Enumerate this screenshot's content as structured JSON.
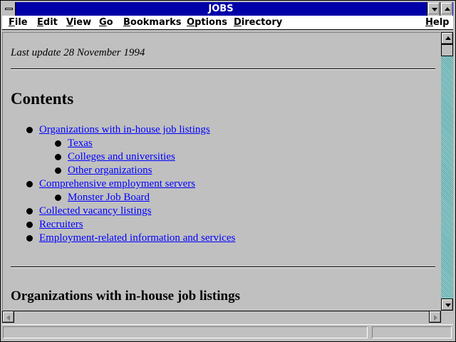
{
  "window": {
    "title": "JOBS"
  },
  "menubar": {
    "items": [
      {
        "label": "File",
        "ul": "F",
        "rest": "ile"
      },
      {
        "label": "Edit",
        "ul": "E",
        "rest": "dit"
      },
      {
        "label": "View",
        "ul": "V",
        "rest": "iew"
      },
      {
        "label": "Go",
        "ul": "G",
        "rest": "o"
      },
      {
        "label": "Bookmarks",
        "ul": "B",
        "rest": "ookmarks"
      },
      {
        "label": "Options",
        "ul": "O",
        "rest": "ptions"
      },
      {
        "label": "Directory",
        "ul": "D",
        "rest": "irectory"
      },
      {
        "label": "Help",
        "ul": "H",
        "rest": "elp"
      }
    ]
  },
  "document": {
    "last_update": "Last update 28 November 1994",
    "contents_heading": "Contents",
    "toc": [
      {
        "label": "Organizations with in-house job listings",
        "level": 1
      },
      {
        "label": "Texas",
        "level": 2
      },
      {
        "label": "Colleges and universities",
        "level": 2
      },
      {
        "label": "Other organizations",
        "level": 2
      },
      {
        "label": "Comprehensive employment servers",
        "level": 1
      },
      {
        "label": "Monster Job Board",
        "level": 2
      },
      {
        "label": "Collected vacancy listings",
        "level": 1
      },
      {
        "label": "Recruiters",
        "level": 1
      },
      {
        "label": "Employment-related information and services",
        "level": 1
      }
    ],
    "section_heading": "Organizations with in-house job listings"
  },
  "scrollbars": {
    "vertical_icons": [
      "scroll-up-arrow-icon",
      "scroll-down-arrow-icon"
    ],
    "horizontal_icons": [
      "scroll-left-arrow-icon",
      "scroll-right-arrow-icon"
    ]
  },
  "colors": {
    "titlebar": "#0000a8",
    "link": "#0000ff",
    "background": "#c0c0c0",
    "scroll_track": "#5fa8a8"
  }
}
